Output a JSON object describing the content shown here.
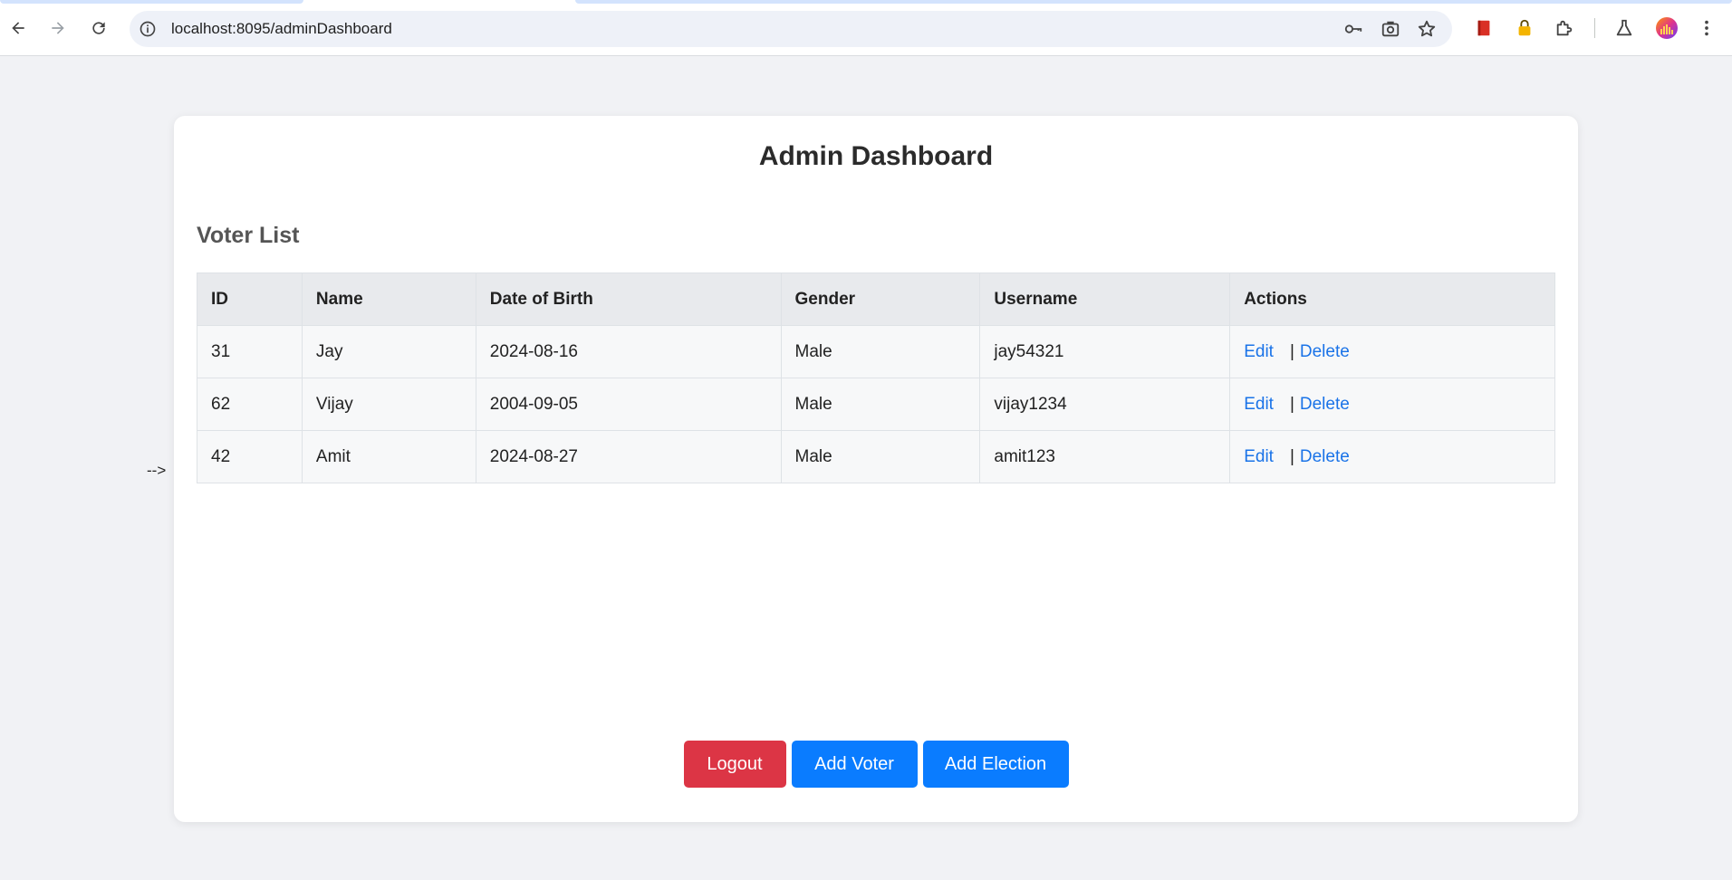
{
  "browser": {
    "url": "localhost:8095/adminDashboard"
  },
  "page": {
    "title": "Admin Dashboard",
    "section_title": "Voter List",
    "stray_text": "-->"
  },
  "table": {
    "headers": [
      "ID",
      "Name",
      "Date of Birth",
      "Gender",
      "Username",
      "Actions"
    ],
    "rows": [
      {
        "id": "31",
        "name": "Jay",
        "dob": "2024-08-16",
        "gender": "Male",
        "username": "jay54321",
        "edit": "Edit",
        "sep": "|",
        "delete": "Delete"
      },
      {
        "id": "62",
        "name": "Vijay",
        "dob": "2004-09-05",
        "gender": "Male",
        "username": "vijay1234",
        "edit": "Edit",
        "sep": "|",
        "delete": "Delete"
      },
      {
        "id": "42",
        "name": "Amit",
        "dob": "2024-08-27",
        "gender": "Male",
        "username": "amit123",
        "edit": "Edit",
        "sep": "|",
        "delete": "Delete"
      }
    ]
  },
  "buttons": {
    "logout": "Logout",
    "add_voter": "Add Voter",
    "add_election": "Add Election"
  },
  "colors": {
    "logout": "#dc3545",
    "primary": "#0a7cff",
    "link": "#1a73e8"
  }
}
